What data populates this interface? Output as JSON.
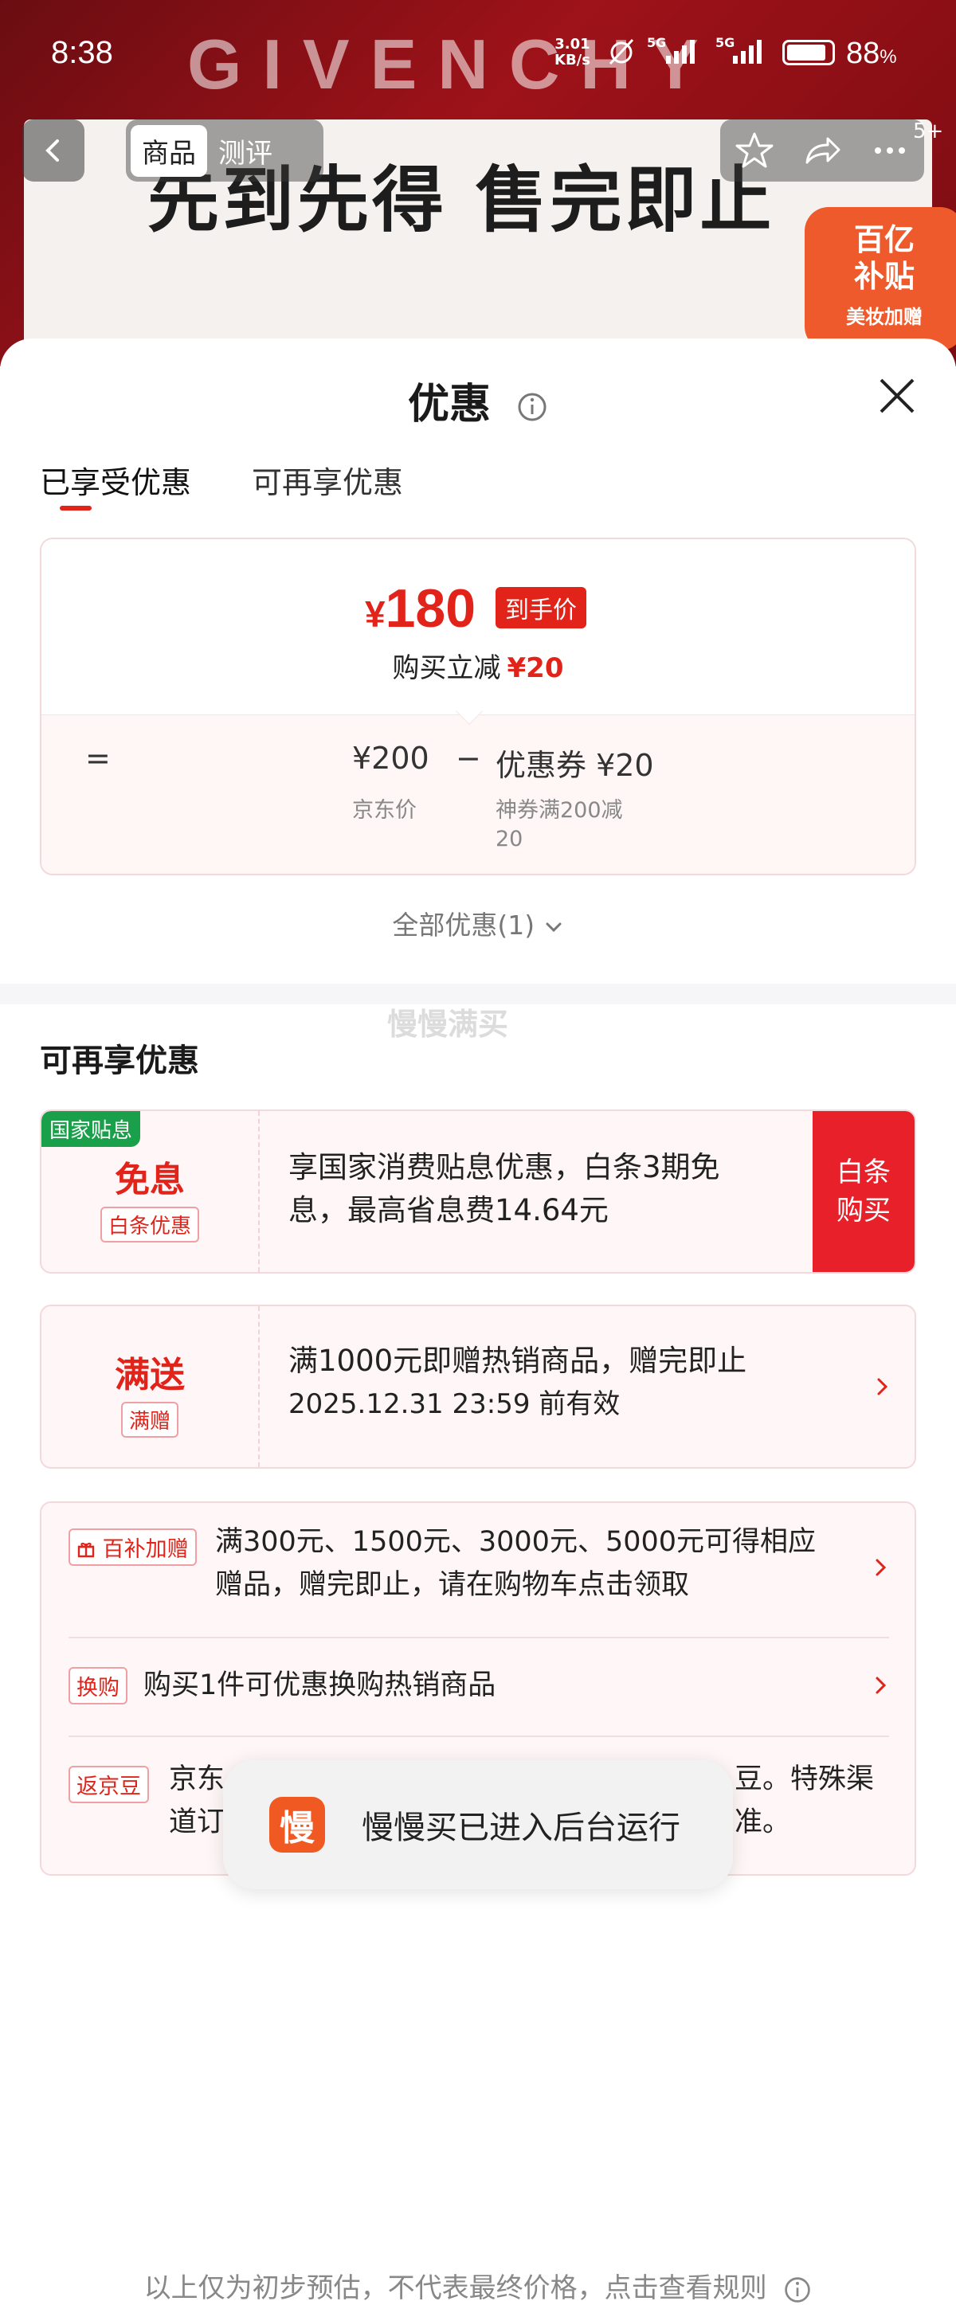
{
  "status_bar": {
    "time": "8:38",
    "net_speed_value": "3.01",
    "net_speed_unit": "KB/s",
    "signal1_label": "5G",
    "signal2_label": "5G",
    "battery_percent": "88",
    "battery_unit": "%",
    "battery_level": 0.88
  },
  "background": {
    "brand_logo": "GIVENCHY",
    "slogan": "先到先得 售完即止",
    "badge_line1": "百亿",
    "badge_line2": "补贴",
    "badge_line3": "美妆加赠"
  },
  "nav": {
    "tab_product": "商品",
    "tab_review": "测评",
    "more_count": "5+"
  },
  "sheet": {
    "title": "优惠",
    "tab_enjoyed": "已享受优惠",
    "tab_more": "可再享优惠",
    "price_symbol": "¥",
    "price_value": "180",
    "price_tag": "到手价",
    "reduce_label": "购买立减",
    "reduce_amount": "¥20",
    "formula_eq": "=",
    "formula_base": "¥200",
    "formula_minus": "−",
    "formula_coupon": "优惠券 ¥20",
    "base_label": "京东价",
    "coupon_label_line1": "神券满200减",
    "coupon_label_line2": "20",
    "all_offers": "全部优惠(1)",
    "watermark": "慢慢满买",
    "section2_title": "可再享优惠",
    "offer1": {
      "corner": "国家贴息",
      "big": "免息",
      "tag": "白条优惠",
      "line1": "享国家消费贴息优惠，白条3期免",
      "line2": "息，最高省息费14.64元",
      "button_line1": "白条",
      "button_line2": "购买"
    },
    "offer2": {
      "big": "满送",
      "tag": "满赠",
      "line1": "满1000元即赠热销商品，赠完即止",
      "line2": "2025.12.31 23:59 前有效"
    },
    "list": {
      "row1_tag": "百补加赠",
      "row1_line1": "满300元、1500元、3000元、5000元可得相应",
      "row1_line2": "赠品，赠完即止，请在购物车点击领取",
      "row2_tag": "换购",
      "row2_text": "购买1件可优惠换购热销商品",
      "row3_tag": "返京豆",
      "row3_line1_start": "京东",
      "row3_line1_end": "豆。特殊渠",
      "row3_line2_start": "道订",
      "row3_line2_end": "准。"
    },
    "footer": "以上仅为初步预估，不代表最终价格，点击查看规则"
  },
  "toast": {
    "icon_char": "慢",
    "text": "慢慢买已进入后台运行"
  },
  "colors": {
    "accent": "#e2231a",
    "green_tag": "#1aa04a",
    "toast_icon": "#f05a22"
  }
}
